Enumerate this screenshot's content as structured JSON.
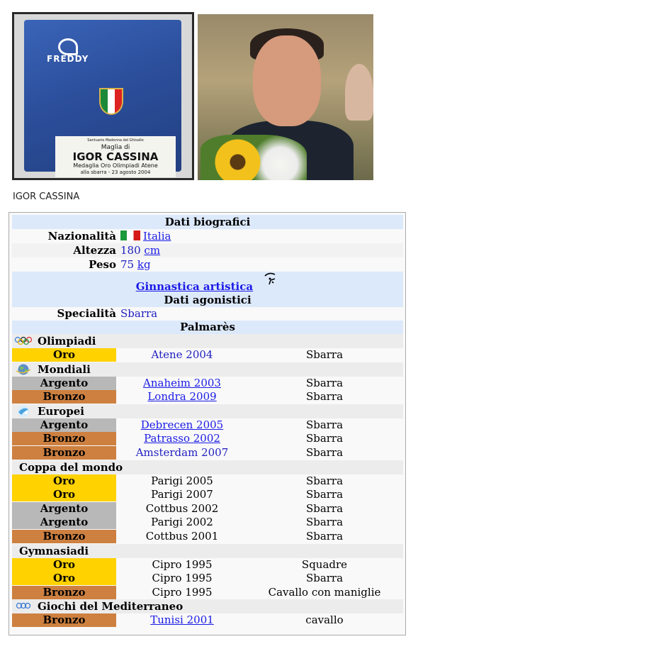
{
  "photos": {
    "jersey": {
      "brand": "FREDDY",
      "plaque_line1": "Santuario Madonna del Ghisallo",
      "plaque_line2": "Maglia di",
      "plaque_line3": "IGOR CASSINA",
      "plaque_line4": "Medaglia Oro Olimpiadi Atene",
      "plaque_line5": "alla sbarra - 23 agosto 2004"
    }
  },
  "caption": "IGOR CASSINA",
  "infobox": {
    "bio_header": "Dati biografici",
    "nationality_label": "Nazionalità",
    "nationality_value": "Italia",
    "height_label": "Altezza",
    "height_value": "180",
    "height_unit": "cm",
    "weight_label": "Peso",
    "weight_value": "75",
    "weight_unit": "kg",
    "sport": "Ginnastica artistica",
    "sport_icon": "gymnast-icon",
    "agon_header": "Dati agonistici",
    "specialty_label": "Specialità",
    "specialty_value": "Sbarra",
    "palmares_header": "Palmarès",
    "sections": [
      {
        "title": "Olimpiadi",
        "icon": "olympic-rings-icon",
        "rows": [
          {
            "medal": "Oro",
            "tier": "gold",
            "event": "Atene 2004",
            "style": "blue",
            "disc": "Sbarra"
          }
        ]
      },
      {
        "title": "Mondiali",
        "icon": "globe-icon",
        "rows": [
          {
            "medal": "Argento",
            "tier": "silver",
            "event": "Anaheim 2003",
            "style": "link",
            "disc": "Sbarra"
          },
          {
            "medal": "Bronzo",
            "tier": "bronze",
            "event": "Londra 2009",
            "style": "link",
            "disc": "Sbarra"
          }
        ]
      },
      {
        "title": "Europei",
        "icon": "europe-icon",
        "rows": [
          {
            "medal": "Argento",
            "tier": "silver",
            "event": "Debrecen 2005",
            "style": "link",
            "disc": "Sbarra"
          },
          {
            "medal": "Bronzo",
            "tier": "bronze",
            "event": "Patrasso 2002",
            "style": "link",
            "disc": "Sbarra"
          },
          {
            "medal": "Bronzo",
            "tier": "bronze",
            "event": "Amsterdam 2007",
            "style": "blue",
            "disc": "Sbarra"
          }
        ]
      },
      {
        "title": "Coppa del mondo",
        "icon": "",
        "rows": [
          {
            "medal": "Oro",
            "tier": "gold",
            "event": "Parigi 2005",
            "style": "black",
            "disc": "Sbarra"
          },
          {
            "medal": "Oro",
            "tier": "gold",
            "event": "Parigi 2007",
            "style": "black",
            "disc": "Sbarra"
          },
          {
            "medal": "Argento",
            "tier": "silver",
            "event": "Cottbus 2002",
            "style": "black",
            "disc": "Sbarra"
          },
          {
            "medal": "Argento",
            "tier": "silver",
            "event": "Parigi 2002",
            "style": "black",
            "disc": "Sbarra"
          },
          {
            "medal": "Bronzo",
            "tier": "bronze",
            "event": "Cottbus 2001",
            "style": "black",
            "disc": "Sbarra"
          }
        ]
      },
      {
        "title": "Gymnasiadi",
        "icon": "",
        "rows": [
          {
            "medal": "Oro",
            "tier": "gold",
            "event": "Cipro 1995",
            "style": "black",
            "disc": "Squadre"
          },
          {
            "medal": "Oro",
            "tier": "gold",
            "event": "Cipro 1995",
            "style": "black",
            "disc": "Sbarra"
          },
          {
            "medal": "Bronzo",
            "tier": "bronze",
            "event": "Cipro 1995",
            "style": "black",
            "disc": "Cavallo con maniglie"
          }
        ]
      },
      {
        "title": "Giochi del Mediterraneo",
        "icon": "mediterranean-games-icon",
        "rows": [
          {
            "medal": "Bronzo",
            "tier": "bronze",
            "event": "Tunisi 2001",
            "style": "link",
            "disc": "cavallo"
          }
        ]
      }
    ]
  },
  "colors": {
    "header_bg": "#dce9fb",
    "gold": "#ffd200",
    "silver": "#b8b8b8",
    "bronze": "#cd8040",
    "link": "#1a1ae6"
  }
}
